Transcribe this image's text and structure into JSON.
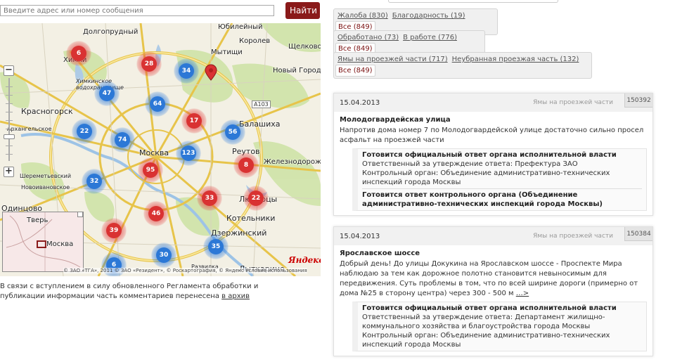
{
  "search": {
    "placeholder": "Введите адрес или номер сообщения",
    "button": "Найти"
  },
  "map": {
    "labels": {
      "dolgoprudny": "Долгопрудный",
      "yubileyny": "Юбилейный",
      "korolev": "Королев",
      "khimki": "Химки",
      "mytishchi": "Мытищи",
      "shchelkovo": "Щелково",
      "khimkinskoe": "Химкинское водохранилище",
      "novy_gorodok": "Новый Городок",
      "krasnogorsk": "Красногорск",
      "balashikha": "Балашиха",
      "arkhangelskoe": "Архангельское",
      "moskva": "Москва",
      "reutov": "Реутов",
      "zheleznodorozhny": "Железнодорожный",
      "sheremetevsky": "Шереметьевский",
      "novoivanovskoe": "Новоивановское",
      "odintsovo": "Одинцово",
      "lyubertsy": "Люберцы",
      "kotelniki": "Котельники",
      "tver": "Тверь",
      "moskva_mini": "Москва",
      "dzerzhinsky": "Дзержинский",
      "lytkarino": "Лыткарино",
      "razvilka": "Развилка",
      "road_a103": "A103"
    },
    "clusters": [
      {
        "n": "6",
        "c": "red"
      },
      {
        "n": "28",
        "c": "red"
      },
      {
        "n": "34",
        "c": "blue"
      },
      {
        "n": "47",
        "c": "blue"
      },
      {
        "n": "64",
        "c": "blue"
      },
      {
        "n": "17",
        "c": "red"
      },
      {
        "n": "22",
        "c": "blue"
      },
      {
        "n": "74",
        "c": "blue"
      },
      {
        "n": "56",
        "c": "blue"
      },
      {
        "n": "123",
        "c": "blue"
      },
      {
        "n": "8",
        "c": "red"
      },
      {
        "n": "95",
        "c": "red"
      },
      {
        "n": "32",
        "c": "blue"
      },
      {
        "n": "33",
        "c": "red"
      },
      {
        "n": "22",
        "c": "red"
      },
      {
        "n": "46",
        "c": "red"
      },
      {
        "n": "39",
        "c": "red"
      },
      {
        "n": "35",
        "c": "blue"
      },
      {
        "n": "30",
        "c": "blue"
      },
      {
        "n": "6",
        "c": "blue"
      }
    ],
    "copyright": "© ЗАО «ТГА», 2011 © ЗАО «Резидент», © Роскартография, © Яндекс   Условия использования",
    "logo": "Яндекс"
  },
  "notice": {
    "text": "В связи с вступлением в силу обновленного Регламента обработки и публикации информации часть комментариев перенесена ",
    "link": "в архив"
  },
  "filters": {
    "type": [
      "Жалоба (830)",
      "Благодарность (19)",
      "Все (849)"
    ],
    "state": [
      "Обработано (73)",
      "В работе (776)",
      "Все (849)"
    ],
    "category": [
      "Ямы на проезжей части (717)",
      "Неубранная проезжая часть (132)",
      "Все (849)"
    ]
  },
  "cards": [
    {
      "date": "15.04.2013",
      "category": "Ямы на проезжей части",
      "number": "150392",
      "title": "Молодогвардейская улица",
      "text": "Напротив дома номер 7 по Молодогвардейской улице достаточно сильно просел асфальт на проезжей части",
      "more": "",
      "status1_title": "Готовится официальный ответ органа исполнительной власти",
      "status1_resp": "Ответственный за утверждение ответа: Префектура ЗАО",
      "status1_ctrl": "Контрольный орган: Объединение административно-технических инспекций города Москвы",
      "status2_title": "Готовится ответ контрольного органа (Объединение административно-технических инспекций города Москвы)"
    },
    {
      "date": "15.04.2013",
      "category": "Ямы на проезжей части",
      "number": "150384",
      "title": "Ярославское шоссе",
      "text": "Добрый день! До улицы Докукина на Ярославском шоссе - Проспекте Мира наблюдаю за тем как дорожное полотно становится невыносимым для передвижения. Суть проблемы в том, что по всей ширине дороги (примерно от дома №25 в сторону центра) через 300 - 500 м ",
      "more": "…>",
      "status1_title": "Готовится официальный ответ органа исполнительной власти",
      "status1_resp": "Ответственный за утверждение ответа: Департамент жилищно-коммунального хозяйства и благоустройства города Москвы",
      "status1_ctrl": "Контрольный орган: Объединение административно-технических инспекций города Москвы"
    }
  ],
  "colors": {
    "accent": "#8a1a1a",
    "cluster_red": "#d93232",
    "cluster_blue": "#2c78d6"
  }
}
